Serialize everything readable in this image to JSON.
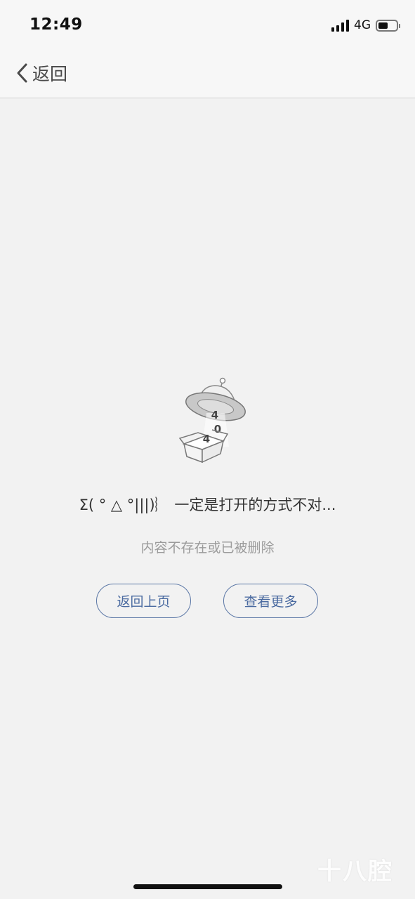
{
  "status_bar": {
    "time": "12:49",
    "network": "4G",
    "battery_level_percent": 55,
    "signal_bars": 4
  },
  "nav": {
    "back_label": "返回",
    "back_icon": "chevron-left-icon"
  },
  "illustration": {
    "icon": "ufo-404-icon",
    "digits": [
      "4",
      "0",
      "4"
    ]
  },
  "error": {
    "title": "Σ( ° △ °|||)︴ 一定是打开的方式不对...",
    "subtitle": "内容不存在或已被删除"
  },
  "buttons": {
    "back_previous": "返回上页",
    "view_more": "查看更多"
  },
  "watermark": {
    "text": "十八腔"
  },
  "colors": {
    "background": "#f2f2f2",
    "nav_background": "#f7f7f7",
    "button_border": "#5b77a6",
    "button_text": "#4a6aa0",
    "subtitle_text": "#9b9b9b"
  }
}
